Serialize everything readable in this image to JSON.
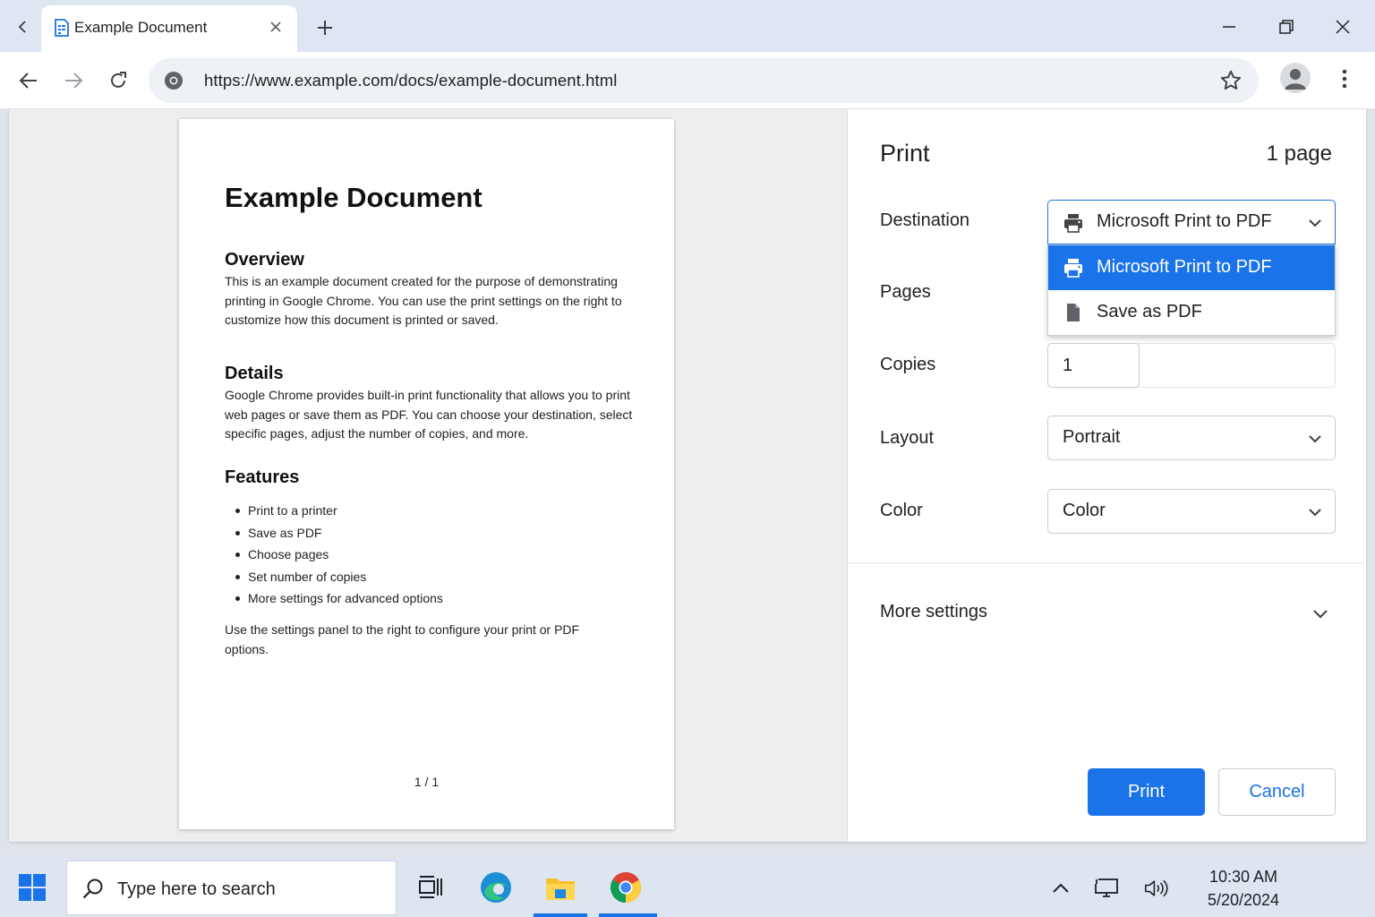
{
  "browser": {
    "tab": {
      "title": "Example Document"
    },
    "url": "https://www.example.com/docs/example-document.html"
  },
  "document": {
    "title": "Example Document",
    "sections": [
      {
        "heading": "Overview",
        "body": "This is an example document created for the purpose of demonstrating printing in Google Chrome. You can use the print settings on the right to customize how this document is printed or saved."
      },
      {
        "heading": "Details",
        "body": "Google Chrome provides built-in print functionality that allows you to print web pages or save them as PDF. You can choose your destination, select specific pages, adjust the number of copies, and more."
      },
      {
        "heading": "Features"
      }
    ],
    "features": [
      "Print to a printer",
      "Save as PDF",
      "Choose pages",
      "Set number of copies",
      "More settings for advanced options"
    ],
    "closing": "Use the settings panel to the right to configure your print or PDF options.",
    "page_number": "1 / 1"
  },
  "print_panel": {
    "title": "Print",
    "page_count": "1 page",
    "labels": {
      "destination": "Destination",
      "pages": "Pages",
      "copies": "Copies",
      "layout": "Layout",
      "color": "Color"
    },
    "destination": {
      "value": "Microsoft Print to PDF",
      "options": [
        {
          "label": "Microsoft Print to PDF",
          "icon": "printer-icon",
          "selected": true
        },
        {
          "label": "Save as PDF",
          "icon": "document-icon",
          "selected": false
        }
      ]
    },
    "copies": "1",
    "layout": "Portrait",
    "color": "Color",
    "more_settings": "More settings",
    "print_button": "Print",
    "cancel_button": "Cancel",
    "colors": {
      "accent": "#1a73e8"
    }
  },
  "taskbar": {
    "search_placeholder": "Type here to search",
    "time": "10:30 AM",
    "date": "5/20/2024"
  }
}
